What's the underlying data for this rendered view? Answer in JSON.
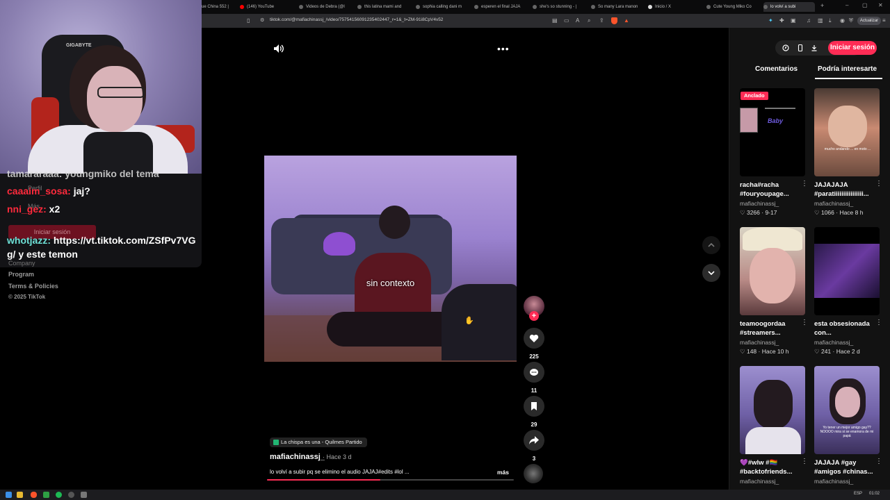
{
  "browser": {
    "tabs": [
      {
        "label": "ue China 552 |"
      },
      {
        "label": "(146) YouTube"
      },
      {
        "label": "Videos de Debra (@l"
      },
      {
        "label": "this latina mami and"
      },
      {
        "label": "sophia calling dani m"
      },
      {
        "label": "esperen el final JAJA"
      },
      {
        "label": "she's so stunning - |"
      },
      {
        "label": "So many Lara manon"
      },
      {
        "label": "Inicio / X"
      },
      {
        "label": "Cute Young Miko Co"
      },
      {
        "label": "lo volví a subi"
      }
    ],
    "url": "tiktok.com/@mafiachinassj_/video/75754156091235402447_r=1&_t=ZM-91i8CpV4v52",
    "update_label": "Actualizar",
    "shield_badge": "0"
  },
  "stream_chat": {
    "cut_line": "tamararaaa: youngmiko del tema",
    "messages": [
      {
        "user": "caaaim_sosa:",
        "text": " jaj?"
      },
      {
        "user": "nni_gez:",
        "text": " x2"
      },
      {
        "user": "whotjazz:",
        "text": " https://vt.tiktok.com/ZSfPv7VG"
      },
      {
        "user": "",
        "text": "g/ y este temon"
      }
    ]
  },
  "sidebar": {
    "ghost_profile": "Perfil",
    "ghost_more": "Más",
    "ghost_login": "Iniciar sesión",
    "ghost_company": "Company",
    "links": [
      "Program",
      "Terms & Policies"
    ],
    "copyright": "© 2025 TikTok"
  },
  "video": {
    "caption": "sin contexto",
    "progress_fraction": 0.46,
    "likes": "225",
    "comments": "11",
    "saves": "29",
    "shares": "3",
    "music": "La chispa es una - Quilmes Partido",
    "author": "mafiachinassj_",
    "posted": "· Hace 3 d",
    "description": "lo volví a subir pq se elimino el audio JAJAJ#edits #lol ...",
    "more": "más"
  },
  "right_panel": {
    "login_label": "Iniciar sesión",
    "tabs": [
      "Comentarios",
      "Podría interesarte"
    ],
    "active_tab": "Podría interesarte",
    "pinned_label": "Anclado",
    "cards": [
      {
        "title": "racha#racha #fouryoupage...",
        "author": "mafiachinassj_",
        "stats": "♡ 3266 · 9-17",
        "thumb_text": "Baby"
      },
      {
        "title": "JAJAJAJA #paratiiiiiiiiiiiiiiii...",
        "author": "mafiachinassj_",
        "stats": "♡ 1066 · Hace 8 h",
        "thumb_text": "mucho andando ... en moto ..."
      },
      {
        "title": "teamoogordaa #streamers...",
        "author": "mafiachinassj_",
        "stats": "♡ 148 · Hace 10 h",
        "thumb_text": ""
      },
      {
        "title": "esta obsesionada con...",
        "author": "mafiachinassj_",
        "stats": "♡ 241 · Hace 2 d",
        "thumb_text": ""
      },
      {
        "title": "💜#wlw #🏳️‍🌈 #backtofriends...",
        "author": "mafiachinassj_",
        "stats": "",
        "thumb_text": ""
      },
      {
        "title": "JAJAJA #gay #amigos #chinas...",
        "author": "mafiachinassj_",
        "stats": "",
        "thumb_text": "Yo tener un mejor amigo gay?? NOOOO mira si se enamora de mi papá"
      }
    ]
  },
  "taskbar": {
    "lang": "ESP",
    "time": "01:02"
  },
  "colors": {
    "accent": "#fe2c55",
    "chat_user": "#ff2a3c",
    "background": "#000000",
    "panel": "#121212"
  }
}
